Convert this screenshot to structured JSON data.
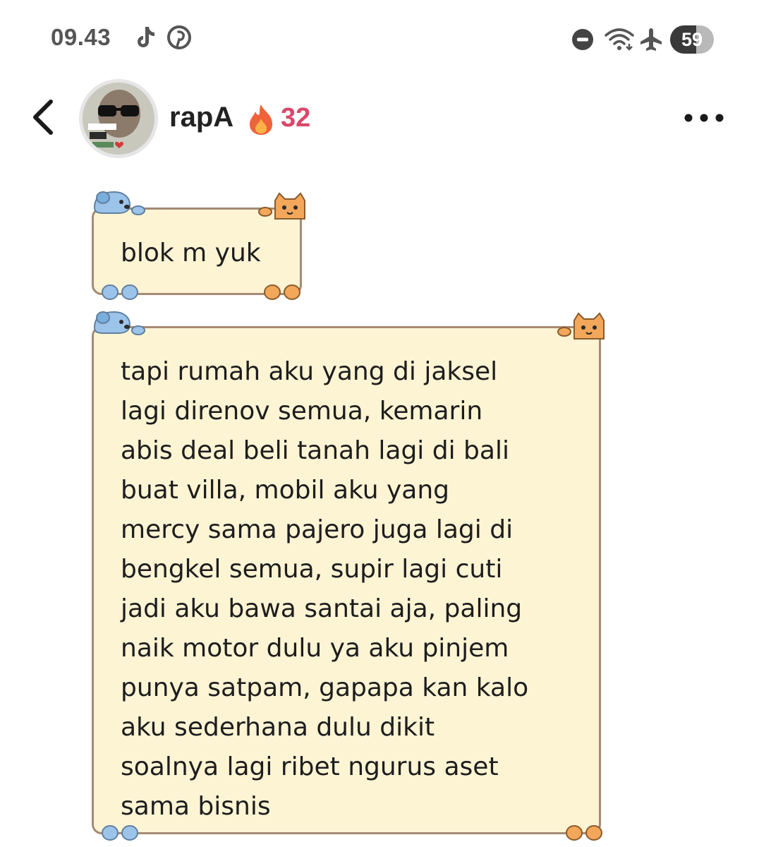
{
  "status_bar": {
    "time": "09.43",
    "battery_level": "59",
    "battery_fraction": 0.59,
    "icons": [
      "tiktok-icon",
      "pinterest-icon",
      "do-not-disturb-icon",
      "wifi-icon",
      "airplane-icon",
      "battery-icon"
    ]
  },
  "header": {
    "username": "rapA",
    "streak_count": "32",
    "icons": [
      "back-chevron-icon",
      "avatar",
      "fire-icon",
      "more-options-icon"
    ]
  },
  "messages": [
    {
      "text": "blok m yuk"
    },
    {
      "text": "tapi rumah aku yang di jaksel\nlagi direnov semua, kemarin\nabis deal beli tanah lagi di bali\nbuat villa, mobil aku yang\nmercy sama pajero juga lagi di\nbengkel semua, supir lagi cuti\njadi aku bawa santai aja, paling\nnaik motor dulu ya aku pinjem\npunya satpam, gapapa kan kalo\naku sederhana dulu dikit\nsoalnya lagi ribet ngurus aset\nsama bisnis"
    }
  ],
  "colors": {
    "bubble_fill": "#fdf4d4",
    "bubble_border": "#a58a74",
    "streak": "#d9486a",
    "dog": "#9cc4ea",
    "cat": "#f2a75a"
  }
}
